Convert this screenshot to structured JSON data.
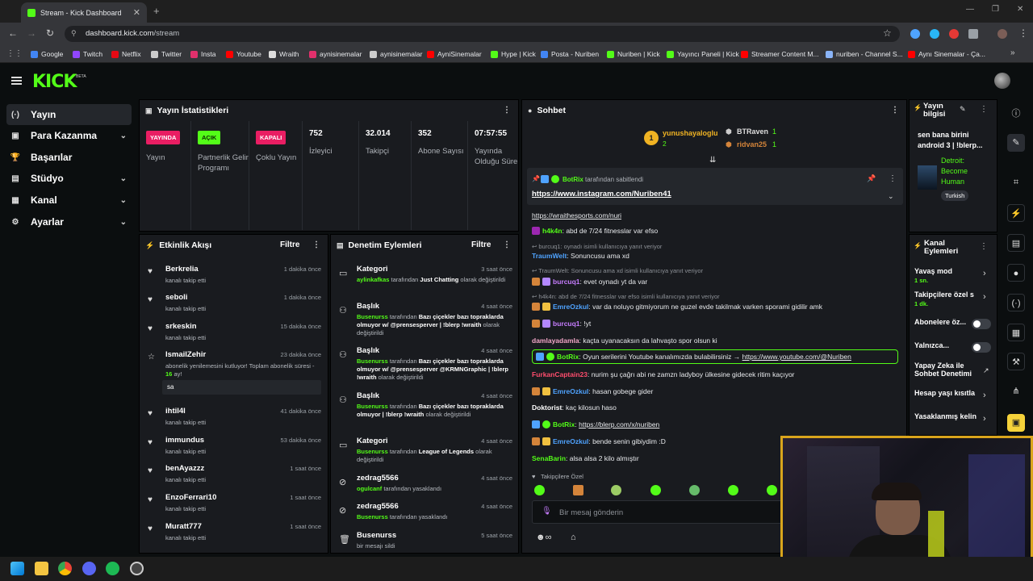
{
  "browser": {
    "tab_title": "Stream - Kick Dashboard",
    "url_host": "dashboard.kick.com",
    "url_path": "/stream",
    "bookmarks": [
      {
        "label": "Google",
        "color": "#4285f4"
      },
      {
        "label": "Twitch",
        "color": "#9146ff"
      },
      {
        "label": "Netflix",
        "color": "#e50914"
      },
      {
        "label": "Twitter",
        "color": "#cccccc"
      },
      {
        "label": "Insta",
        "color": "#e1306c"
      },
      {
        "label": "Youtube",
        "color": "#ff0000"
      },
      {
        "label": "Wraith",
        "color": "#dddddd"
      },
      {
        "label": "aynisinemalar",
        "color": "#e1306c"
      },
      {
        "label": "aynisinemalar",
        "color": "#cccccc"
      },
      {
        "label": "AyniSinemalar",
        "color": "#ff0000"
      },
      {
        "label": "Hype | Kick",
        "color": "#53fc18"
      },
      {
        "label": "Posta - Nuriben",
        "color": "#4285f4"
      },
      {
        "label": "Nuriben | Kick",
        "color": "#53fc18"
      },
      {
        "label": "Yayıncı Paneli | Kick",
        "color": "#53fc18"
      },
      {
        "label": "Streamer Content M...",
        "color": "#ff0000"
      },
      {
        "label": "nuriben - Channel S...",
        "color": "#8ab4f8"
      },
      {
        "label": "Aynı Sinemalar - Ça...",
        "color": "#ff0000"
      }
    ]
  },
  "sidebar": {
    "items": [
      {
        "label": "Yayın",
        "icon": "(·)",
        "chevron": false
      },
      {
        "label": "Para Kazanma",
        "icon": "▣",
        "chevron": true
      },
      {
        "label": "Başarılar",
        "icon": "🏆",
        "chevron": false
      },
      {
        "label": "Stüdyo",
        "icon": "▤",
        "chevron": true
      },
      {
        "label": "Kanal",
        "icon": "▦",
        "chevron": true
      },
      {
        "label": "Ayarlar",
        "icon": "⚙",
        "chevron": true
      }
    ]
  },
  "stats": {
    "title": "Yayın İstatistikleri",
    "items": [
      {
        "badge": "YAYINDA",
        "badge_color": "#e91e63",
        "label": "Yayın"
      },
      {
        "badge": "AÇIK",
        "badge_color": "#53fc18",
        "label": "Partnerlik Gelir Programı"
      },
      {
        "badge": "KAPALI",
        "badge_color": "#e91e63",
        "label": "Çoklu Yayın"
      },
      {
        "value": "752",
        "label": "İzleyici"
      },
      {
        "value": "32.014",
        "label": "Takipçi"
      },
      {
        "value": "352",
        "label": "Abone Sayısı"
      },
      {
        "value": "07:57:55",
        "label": "Yayında Olduğu Süre"
      }
    ]
  },
  "activity": {
    "title": "Etkinlik Akışı",
    "filter": "Filtre",
    "events": [
      {
        "name": "Berkrelia",
        "sub": "kanalı takip etti",
        "time": "1 dakika önce",
        "icon": "♥"
      },
      {
        "name": "seboli",
        "sub": "kanalı takip etti",
        "time": "1 dakika önce",
        "icon": "♥"
      },
      {
        "name": "srkeskin",
        "sub": "kanalı takip etti",
        "time": "15 dakika önce",
        "icon": "♥"
      },
      {
        "name": "IsmailZehir",
        "sub": "abonelik yenilemesini kutluyor! Toplam abonelik süresi -",
        "months": "16",
        "sub2": "ay!",
        "message": "sa",
        "time": "23 dakika önce",
        "icon": "☆"
      },
      {
        "name": "ihtil4l",
        "sub": "kanalı takip etti",
        "time": "41 dakika önce",
        "icon": "♥"
      },
      {
        "name": "immundus",
        "sub": "kanalı takip etti",
        "time": "53 dakika önce",
        "icon": "♥"
      },
      {
        "name": "benAyazzz",
        "sub": "kanalı takip etti",
        "time": "1 saat önce",
        "icon": "♥"
      },
      {
        "name": "EnzoFerrari10",
        "sub": "kanalı takip etti",
        "time": "1 saat önce",
        "icon": "♥"
      },
      {
        "name": "Muratt777",
        "sub": "kanalı takip etti",
        "time": "1 saat önce",
        "icon": "♥"
      }
    ]
  },
  "moderation": {
    "title": "Denetim Eylemleri",
    "filter": "Filtre",
    "actions": [
      {
        "name": "Kategori",
        "time": "3 saat önce",
        "icon": "▭",
        "who": "aylinkafkas",
        "mid": " tarafından ",
        "hl": "Just Chatting",
        "rest": " olarak değiştirildi"
      },
      {
        "name": "Başlık",
        "time": "4 saat önce",
        "icon": "⚇",
        "who": "Busenurss",
        "mid": " tarafından ",
        "hl": "Bazı çiçekler bazı topraklarda olmuyor w/ @prensesperver | !blerp !wraith",
        "rest": " olarak değiştirildi"
      },
      {
        "name": "Başlık",
        "time": "4 saat önce",
        "icon": "⚇",
        "who": "Busenurss",
        "mid": " tarafından ",
        "hl": "Bazı çiçekler bazı topraklarda olmuyor w/ @prensesperver @KRMNGraphic | !blerp !wraith",
        "rest": " olarak değiştirildi"
      },
      {
        "name": "Başlık",
        "time": "4 saat önce",
        "icon": "⚇",
        "who": "Busenurss",
        "mid": " tarafından ",
        "hl": "Bazı çiçekler bazı topraklarda olmuyor | !blerp !wraith",
        "rest": " olarak değiştirildi"
      },
      {
        "name": "Kategori",
        "time": "4 saat önce",
        "icon": "▭",
        "who": "Busenurss",
        "mid": " tarafından ",
        "hl": "League of Legends",
        "rest": " olarak değiştirildi"
      },
      {
        "name": "zedrag5566",
        "time": "4 saat önce",
        "icon": "⊘",
        "who": "ogulcanf",
        "mid": " tarafından yasaklandı",
        "hl": "",
        "rest": ""
      },
      {
        "name": "zedrag5566",
        "time": "4 saat önce",
        "icon": "⊘",
        "who": "Busenurss",
        "mid": " tarafından yasaklandı",
        "hl": "",
        "rest": ""
      },
      {
        "name": "Busenurss",
        "time": "5 saat önce",
        "icon": "🗑",
        "who": "",
        "mid": "bir mesajı sildi",
        "hl": "",
        "rest": ""
      }
    ]
  },
  "chat": {
    "title": "Sohbet",
    "leaders": [
      {
        "name": "yunushayaloglu",
        "count": "2"
      },
      {
        "name": "BTRaven",
        "count": "1"
      },
      {
        "name": "ridvan25",
        "count": "1"
      }
    ],
    "pinned_by": "BotRix",
    "pinned_suffix": "tarafından sabitlendi",
    "pinned_link": "https://www.instagram.com/Nuriben41",
    "first_line": "https://wraithesports.com/nuri",
    "messages": [
      {
        "user": "h4k4n",
        "color": "#53fc18",
        "text": "abd de 7/24 fitnesslar var efso",
        "badges": [
          "#9c27b0"
        ]
      },
      {
        "reply": "burcuq1: oynadı isimli kullanıcıya yanıt veriyor"
      },
      {
        "user": "TraumWelt",
        "color": "#4fa3ff",
        "text": "Sonuncusu ama xd",
        "badges": []
      },
      {
        "reply": "TraumWelt: Sonuncusu ama xd isimli kullanıcıya yanıt veriyor"
      },
      {
        "user": "burcuq1",
        "color": "#c77dff",
        "text": "evet oynadı yt da var",
        "badges": [
          "#d4843a",
          "#b388ff"
        ]
      },
      {
        "reply": "h4k4n: abd de 7/24 fitnesslar var efso isimli kullanıcıya yanıt veriyor"
      },
      {
        "user": "EmreOzkul",
        "color": "#4fa3ff",
        "text": "var da noluyo gitmiyorum ne guzel evde takilmak varken sporami gidilir amk",
        "badges": [
          "#d4843a",
          "#f0c040"
        ]
      },
      {
        "user": "burcuq1",
        "color": "#c77dff",
        "text": "!yt",
        "badges": [
          "#d4843a",
          "#b388ff"
        ]
      },
      {
        "user": "damlayadamla",
        "color": "#f3a6c8",
        "text": "kaçta uyanacaksın da lahvaşto spor olsun ki",
        "badges": []
      },
      {
        "user": "BotRix",
        "color": "#53fc18",
        "text": "Oyun serilerini Youtube kanalımızda bulabilirsiniz → ",
        "link": "https://www.youtube.com/@Nuriben",
        "badges": [
          "#4fa3ff",
          "#53fc18"
        ],
        "highlight": true
      },
      {
        "user": "FurkanCaptain23",
        "color": "#ff4d6d",
        "text": "nurim şu çağrı abi ne zamzn ladyboy ülkesine gidecek ritim kaçıyor",
        "badges": []
      },
      {
        "user": "EmreOzkul",
        "color": "#4fa3ff",
        "text": "hasan gobege gider",
        "badges": [
          "#d4843a",
          "#f0c040"
        ]
      },
      {
        "user": "Doktorist",
        "color": "#ffffff",
        "text": "kaç kilosun haso",
        "badges": []
      },
      {
        "user": "BotRix",
        "color": "#53fc18",
        "text": "",
        "link": "https://blerp.com/x/nuriben",
        "badges": [
          "#4fa3ff",
          "#53fc18"
        ]
      },
      {
        "user": "EmreOzkul",
        "color": "#4fa3ff",
        "text": "bende senin gibiydim :D",
        "badges": [
          "#d4843a",
          "#f0c040"
        ]
      },
      {
        "user": "SenaBarin",
        "color": "#53fc18",
        "text": "alsa alsa 2 kilo almıştır",
        "badges": []
      }
    ],
    "followers_only": "Takipçilere Özel",
    "input_placeholder": "Bir mesaj gönderin"
  },
  "stream_info": {
    "title": "Yayın bilgisi",
    "stream_title": "sen bana birini android 3 | !blerp...",
    "category": "Detroit: Become Human",
    "language": "Turkish"
  },
  "channel_actions": {
    "title": "Kanal Eylemleri",
    "items": [
      {
        "label": "Yavaş mod",
        "value": "1 sn.",
        "control": "chevron"
      },
      {
        "label": "Takipçilere özel s",
        "value": "1 dk.",
        "control": "chevron"
      },
      {
        "label": "Abonelere öz...",
        "value": "",
        "control": "toggle"
      },
      {
        "label": "Yalnızca...",
        "value": "",
        "control": "toggle"
      },
      {
        "label": "Yapay Zeka ile Sohbet Denetimi",
        "value": "",
        "control": "external"
      },
      {
        "label": "Hesap yaşı kısıtla",
        "value": "",
        "control": "chevron"
      },
      {
        "label": "Yasaklanmış kelin",
        "value": "",
        "control": "chevron"
      }
    ]
  },
  "colors": {
    "accent": "#53fc18",
    "live": "#e91e63",
    "panel": "#191b1f"
  }
}
